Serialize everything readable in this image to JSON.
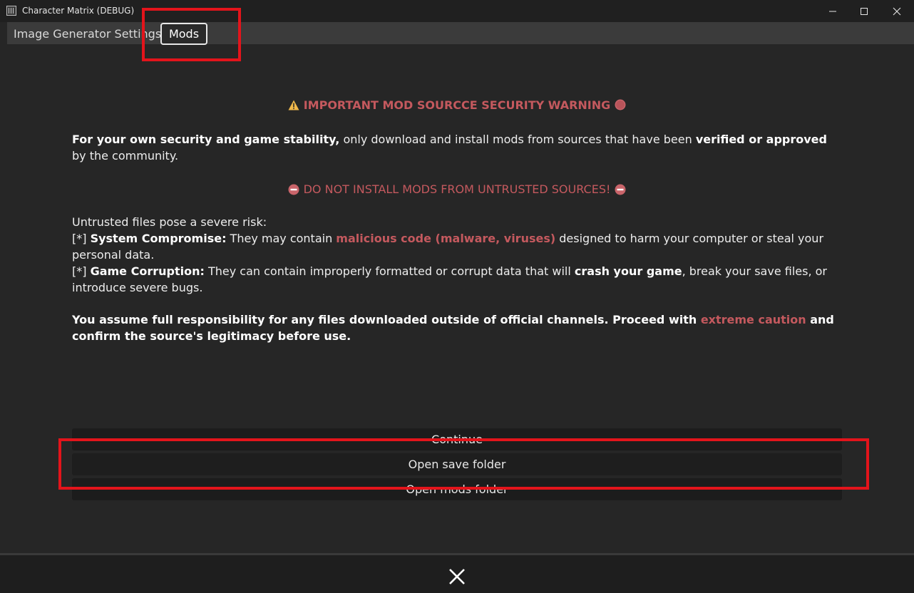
{
  "window": {
    "title": "Character Matrix (DEBUG)",
    "controls": {
      "minimize_icon": "minimize-icon",
      "maximize_icon": "maximize-icon",
      "close_icon": "close-icon"
    }
  },
  "tabs": [
    {
      "label": "Image Generator Settings",
      "selected": false
    },
    {
      "label": "Mods",
      "selected": true
    }
  ],
  "warning": {
    "title": "IMPORTANT MOD SOURCCE SECURITY WARNING",
    "title_icon_left": "warning-triangle-icon",
    "title_icon_right": "stop-circle-icon",
    "security_bold": "For your own security and game stability,",
    "security_text_1": " only download and install mods from sources that have been ",
    "security_bold_2": "verified or approved",
    "security_text_2": " by the community.",
    "subtitle": "DO NOT INSTALL MODS FROM UNTRUSTED SOURCES!",
    "subtitle_icon": "no-entry-icon",
    "risk_intro": "Untrusted files pose a severe risk:",
    "risk1_prefix": "[*] ",
    "risk1_bold": "System Compromise:",
    "risk1_text_1": " They may contain ",
    "risk1_accent": "malicious code (malware, viruses)",
    "risk1_text_2": " designed to harm your computer or steal your personal data.",
    "risk2_prefix": "[*] ",
    "risk2_bold": "Game Corruption:",
    "risk2_text_1": " They can contain improperly formatted or corrupt data that will ",
    "risk2_bold_2": "crash your game",
    "risk2_text_2": ", break your save files, or introduce severe bugs.",
    "final_text_1": "You assume full responsibility for any files downloaded outside of official channels. Proceed with ",
    "final_accent": "extreme caution",
    "final_text_2": " and confirm the source's legitimacy before use."
  },
  "buttons": {
    "continue": "Continue",
    "open_save_folder": "Open save folder",
    "open_mods_folder": "Open mods folder"
  },
  "footer": {
    "close_icon": "close-x-icon"
  },
  "colors": {
    "accent_red": "#c4595e",
    "annotation_red": "#e3141b",
    "background": "#262626"
  }
}
